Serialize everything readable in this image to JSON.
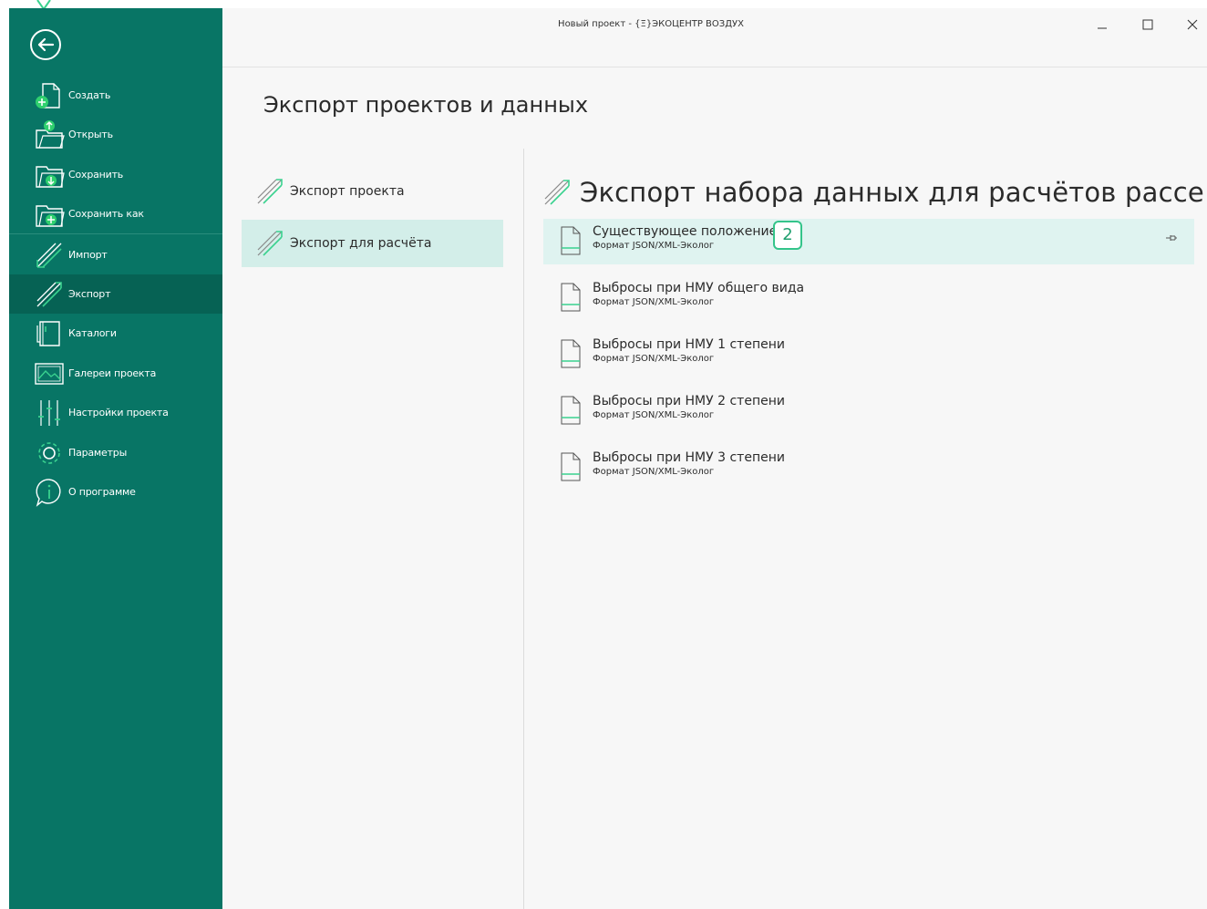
{
  "window": {
    "title": "Новый проект - {Ξ}ЭКОЦЕНТР ВОЗДУХ",
    "controls": [
      "minimize-icon",
      "maximize-icon",
      "close-icon"
    ]
  },
  "sidebar": {
    "back_icon": "arrow-left-circle-icon",
    "items": [
      {
        "label": "Создать",
        "icon": "new-document-icon"
      },
      {
        "label": "Открыть",
        "icon": "open-folder-icon"
      },
      {
        "label": "Сохранить",
        "icon": "save-folder-icon"
      },
      {
        "label": "Сохранить как",
        "icon": "save-as-folder-icon"
      },
      {
        "label": "Импорт",
        "icon": "import-arrows-icon"
      },
      {
        "label": "Экспорт",
        "icon": "export-arrows-icon",
        "active": true
      },
      {
        "label": "Каталоги",
        "icon": "catalog-book-icon"
      },
      {
        "label": "Галереи проекта",
        "icon": "gallery-image-icon"
      },
      {
        "label": "Настройки проекта",
        "icon": "sliders-icon"
      },
      {
        "label": "Параметры",
        "icon": "gear-icon"
      },
      {
        "label": "О программе",
        "icon": "info-bubble-icon"
      }
    ]
  },
  "main": {
    "page_title": "Экспорт проектов и данных",
    "left_list": [
      {
        "label": "Экспорт проекта",
        "icon": "export-arrows-icon",
        "selected": false
      },
      {
        "label": "Экспорт для расчёта",
        "icon": "export-arrows-icon",
        "selected": true
      }
    ],
    "right_title": "Экспорт набора данных для расчётов рассе…",
    "datasets": [
      {
        "name": "Существующее положение",
        "format": "Формат JSON/XML-Эколог",
        "highlighted": true,
        "badge": "2"
      },
      {
        "name": "Выбросы при НМУ общего вида",
        "format": "Формат JSON/XML-Эколог"
      },
      {
        "name": "Выбросы при НМУ 1 степени",
        "format": "Формат JSON/XML-Эколог"
      },
      {
        "name": "Выбросы при НМУ 2 степени",
        "format": "Формат JSON/XML-Эколог"
      },
      {
        "name": "Выбросы при НМУ 3 степени",
        "format": "Формат JSON/XML-Эколог"
      }
    ],
    "pin_icon": "pin-icon"
  },
  "colors": {
    "sidebar_bg": "#087565",
    "sidebar_active": "#066254",
    "accent_green": "#34c48a",
    "selected_bg": "#d3eee9",
    "highlight_bg": "#dff3f0"
  }
}
